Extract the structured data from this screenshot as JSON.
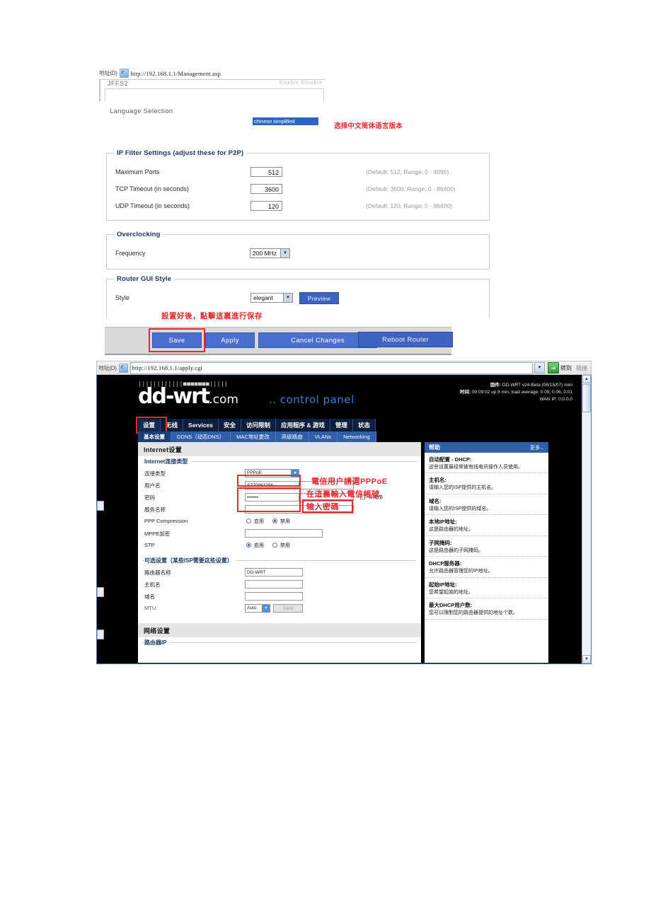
{
  "top_browser": {
    "address_label": "地址(D)",
    "url": "http://192.168.1.1/Management.asp",
    "clipped_text": "JFFS2",
    "ghost_right": "Enable   Disable"
  },
  "language": {
    "label": "Language Selection",
    "selected": "chinese simplified",
    "note": "选择中文简体语言版本"
  },
  "ip_filter": {
    "legend": "IP Filter Settings (adjust these for P2P)",
    "rows": [
      {
        "label": "Maximum Ports",
        "value": "512",
        "hint": "(Default: 512, Range: 0 - 4096)"
      },
      {
        "label": "TCP Timeout (in seconds)",
        "value": "3600",
        "hint": "(Default: 3600, Range: 0 - 86400)"
      },
      {
        "label": "UDP Timeout (in seconds)",
        "value": "120",
        "hint": "(Default: 120, Range: 0 - 86400)"
      }
    ]
  },
  "overclocking": {
    "legend": "Overclocking",
    "row_label": "Frequency",
    "value": "200 MHz"
  },
  "gui_style": {
    "legend": "Router GUI Style",
    "row_label": "Style",
    "value": "elegant",
    "preview_button": "Preview",
    "note": "設置好後，點擊這裏進行保存"
  },
  "buttons": {
    "save": "Save",
    "apply": "Apply",
    "cancel": "Cancel Changes",
    "reboot": "Reboot Router"
  },
  "ddwrt": {
    "address_label": "地址(D)",
    "url": "http://192.168.1.1/apply.cgi",
    "go_label": "转到",
    "links_label": "链接",
    "logo": "dd-wrt",
    "logo_suffix": ".com",
    "control_panel": ".. control panel",
    "dots": "||||||||||||■■■■■■■|||||",
    "meta": {
      "firmware_label": "固件:",
      "firmware_value": "DD-WRT v24-Beta (08/15/07) mini",
      "time_label": "时间:",
      "time_value": "00:09:02 up 8 min, load average: 0.09, 0.06, 0.01",
      "wan_label": "WAN IP:",
      "wan_value": "0.0.0.0"
    },
    "tabs": [
      {
        "label": "设置",
        "active": true
      },
      {
        "label": "无线",
        "active": false
      },
      {
        "label": "Services",
        "active": false
      },
      {
        "label": "安全",
        "active": false
      },
      {
        "label": "访问限制",
        "active": false
      },
      {
        "label": "应用程序 & 游戏",
        "active": false
      },
      {
        "label": "管理",
        "active": false
      },
      {
        "label": "状态",
        "active": false
      }
    ],
    "subtabs": [
      {
        "label": "基本设置",
        "active": true
      },
      {
        "label": "DDNS（动态DNS）",
        "active": false
      },
      {
        "label": "MAC地址更改",
        "active": false
      },
      {
        "label": "高级路由",
        "active": false
      },
      {
        "label": "VLANs",
        "active": false
      },
      {
        "label": "Networking",
        "active": false
      }
    ],
    "section_internet": "Internet设置",
    "fieldset_conn": "Internet连接类型",
    "conn": {
      "type_label": "连接类型",
      "type_value": "PPPoE",
      "user_label": "用户名",
      "user_value": "SZ70963256",
      "pass_label": "密码",
      "pass_value": "•••••••",
      "unmask_label": "非掩饰",
      "service_label": "服务名称",
      "service_value": "",
      "ppp_comp_label": "PPP Compression",
      "ppp_enable": "启用",
      "ppp_disable": "禁用",
      "mppe_label": "MPPE加密",
      "mppe_value": "",
      "stp_label": "STP",
      "stp_enable": "启用",
      "stp_disable": "禁用"
    },
    "annotations": {
      "a1": "電信用户請選PPPoE",
      "a2": "在這裏輸入電信帳號",
      "a3": "输入密碼"
    },
    "fieldset_optional": "可选设置（某些ISP需要这些设置）",
    "optional": {
      "router_name_label": "路由器名称",
      "router_name_value": "DD-WRT",
      "host_label": "主机名",
      "host_value": "",
      "domain_label": "域名",
      "domain_value": "",
      "mtu_label": "MTU",
      "mtu_value": "Auto",
      "mtu_number": "1500"
    },
    "section_network": "网络设置",
    "fieldset_routerip": "路由器IP",
    "help": {
      "title": "帮助",
      "more": "更多...",
      "items": [
        {
          "title": "自动配置 - DHCP:",
          "body": "这些设置最经常被有线电讯操作人员使用。"
        },
        {
          "title": "主机名:",
          "body": "请输入您的ISP提供的主机名。"
        },
        {
          "title": "域名:",
          "body": "请输入您的ISP提供的域名。"
        },
        {
          "title": "本地IP地址:",
          "body": "这是路由器的地址。"
        },
        {
          "title": "子网掩码:",
          "body": "这是路由器的子网掩码。"
        },
        {
          "title": "DHCP服务器:",
          "body": "允许路由器管理您的IP地址。"
        },
        {
          "title": "起始IP地址:",
          "body": "您希望起始的地址。"
        },
        {
          "title": "最大DHCP用户数:",
          "body": "您可以限制您的路由器提供的地址个数。"
        }
      ]
    }
  }
}
